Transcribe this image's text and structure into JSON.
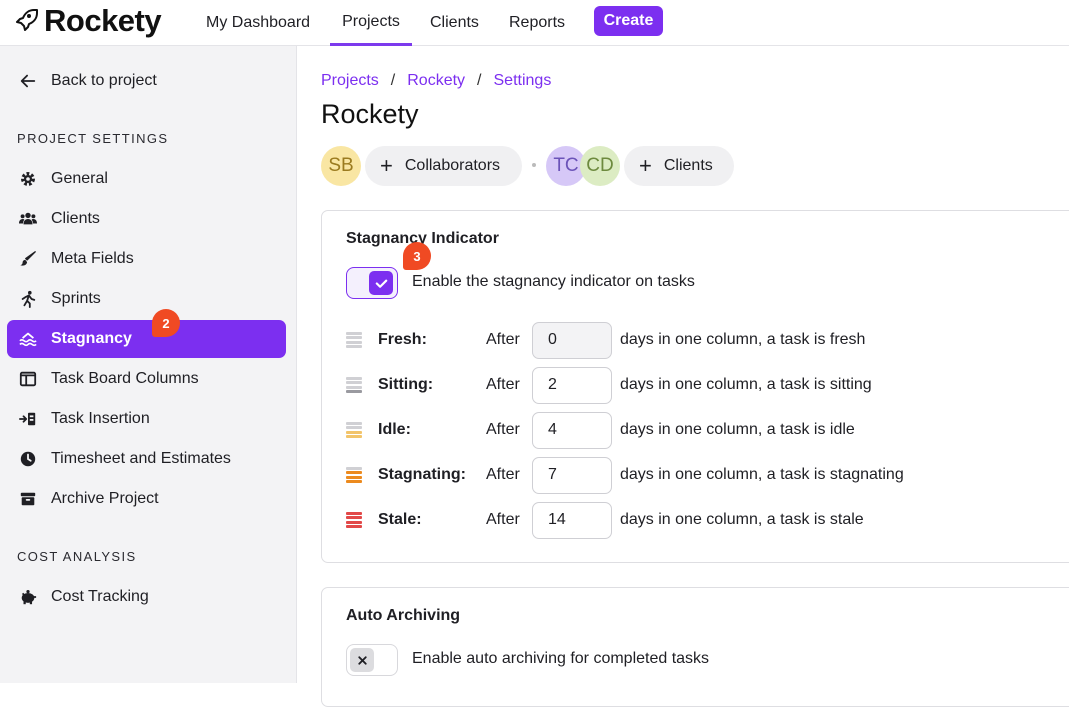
{
  "app": {
    "name": "Rockety"
  },
  "nav": {
    "items": [
      "My Dashboard",
      "Projects",
      "Clients",
      "Reports"
    ],
    "active": "Projects",
    "create_label": "Create"
  },
  "sidebar": {
    "back_label": "Back to project",
    "section1": "PROJECT SETTINGS",
    "items": [
      {
        "label": "General",
        "icon": "gear-icon"
      },
      {
        "label": "Clients",
        "icon": "users-icon"
      },
      {
        "label": "Meta Fields",
        "icon": "brush-icon"
      },
      {
        "label": "Sprints",
        "icon": "runner-icon"
      },
      {
        "label": "Stagnancy",
        "icon": "water-icon",
        "badge": "2"
      },
      {
        "label": "Task Board Columns",
        "icon": "columns-icon"
      },
      {
        "label": "Task Insertion",
        "icon": "insert-icon"
      },
      {
        "label": "Timesheet and Estimates",
        "icon": "clock-icon"
      },
      {
        "label": "Archive Project",
        "icon": "archive-icon"
      }
    ],
    "section2": "COST ANALYSIS",
    "cost_items": [
      {
        "label": "Cost Tracking",
        "icon": "piggy-bank-icon"
      }
    ]
  },
  "breadcrumb": [
    "Projects",
    "Rockety",
    "Settings"
  ],
  "page_title": "Rockety",
  "collaborators": {
    "avatars": [
      "SB"
    ],
    "button_label": "Collaborators"
  },
  "clients": {
    "avatars": [
      "TC",
      "CD"
    ],
    "button_label": "Clients"
  },
  "stagnancy": {
    "title": "Stagnancy Indicator",
    "toggle_label": "Enable the stagnancy indicator on tasks",
    "toggle_on": true,
    "badge": "3",
    "after_label": "After",
    "rows": [
      {
        "label": "Fresh:",
        "value": "0",
        "desc": "days in one column, a task is fresh",
        "color": "#d0d0d4"
      },
      {
        "label": "Sitting:",
        "value": "2",
        "desc": "days in one column, a task is sitting",
        "color": "#9a9aa0"
      },
      {
        "label": "Idle:",
        "value": "4",
        "desc": "days in one column, a task is idle",
        "color": "#f2c46a"
      },
      {
        "label": "Stagnating:",
        "value": "7",
        "desc": "days in one column, a task is stagnating",
        "color": "#ec8a1e"
      },
      {
        "label": "Stale:",
        "value": "14",
        "desc": "days in one column, a task is stale",
        "color": "#e24848"
      }
    ]
  },
  "archiving": {
    "title": "Auto Archiving",
    "toggle_label": "Enable auto archiving for completed tasks",
    "toggle_on": false
  },
  "colors": {
    "accent": "#7c2ff0",
    "badge": "#f04a23"
  }
}
